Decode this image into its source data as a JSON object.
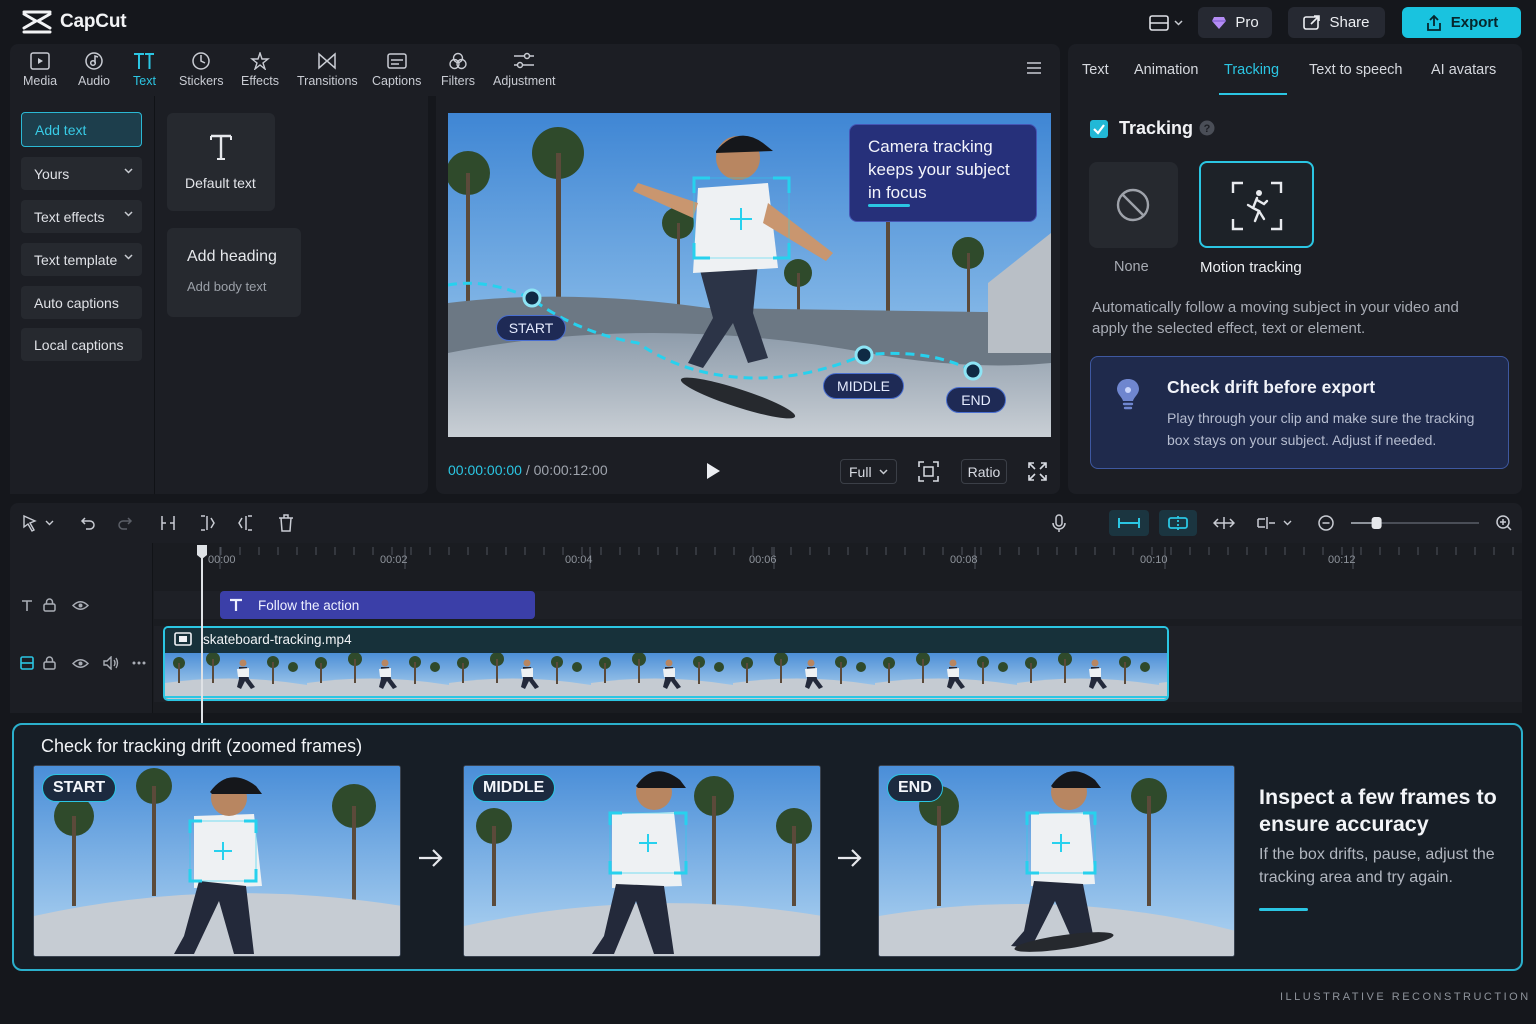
{
  "app": {
    "name": "CapCut"
  },
  "header": {
    "pro_label": "Pro",
    "share_label": "Share",
    "export_label": "Export"
  },
  "toolbar": {
    "tools": [
      "Media",
      "Audio",
      "Text",
      "Stickers",
      "Effects",
      "Transitions",
      "Captions",
      "Filters",
      "Adjustment"
    ],
    "active": "Text"
  },
  "left_panel": {
    "add_text": "Add text",
    "yours": "Yours",
    "text_effects": "Text effects",
    "text_template": "Text template",
    "auto_captions": "Auto captions",
    "local_captions": "Local captions"
  },
  "text_cards": {
    "default_text": "Default text",
    "heading": "Add heading",
    "body": "Add body text"
  },
  "preview": {
    "callout": "Camera tracking keeps your subject in focus",
    "labels": {
      "start": "START",
      "middle": "MIDDLE",
      "end": "END"
    },
    "time_current": "00:00:00:00",
    "time_separator": "/",
    "time_total": "00:00:12:00",
    "zoom": "Full",
    "ratio": "Ratio"
  },
  "right_panel": {
    "tabs": [
      "Text",
      "Animation",
      "Tracking",
      "Text to speech",
      "AI avatars"
    ],
    "active_tab": "Tracking",
    "tracking_title": "Tracking",
    "option_none": "None",
    "option_motion": "Motion tracking",
    "description": "Automatically follow a moving subject in your video and apply the selected effect, text or element.",
    "tip_title": "Check drift before export",
    "tip_body": "Play through your clip and make sure the tracking box stays on your subject. Adjust if needed."
  },
  "timeline": {
    "ticks": [
      "00:00",
      "00:02",
      "00:04",
      "00:06",
      "00:08",
      "00:10",
      "00:12"
    ],
    "text_clip": "Follow the action",
    "video_clip": "skateboard-tracking.mp4",
    "zoom_level": 0.2
  },
  "drift_panel": {
    "title_bold": "Check for tracking drift",
    "title_rest": "(zoomed frames)",
    "frames": [
      "START",
      "MIDDLE",
      "END"
    ],
    "inspect_title": "Inspect a few frames to ensure accuracy",
    "inspect_body": "If the box drifts, pause, adjust the tracking area and try again."
  },
  "footer": "ILLUSTRATIVE RECONSTRUCTION",
  "colors": {
    "accent": "#2bc6e3",
    "background": "#15171c",
    "panel": "#1c1e24",
    "text_clip": "#3b3fa8",
    "callout": "#26307a"
  }
}
